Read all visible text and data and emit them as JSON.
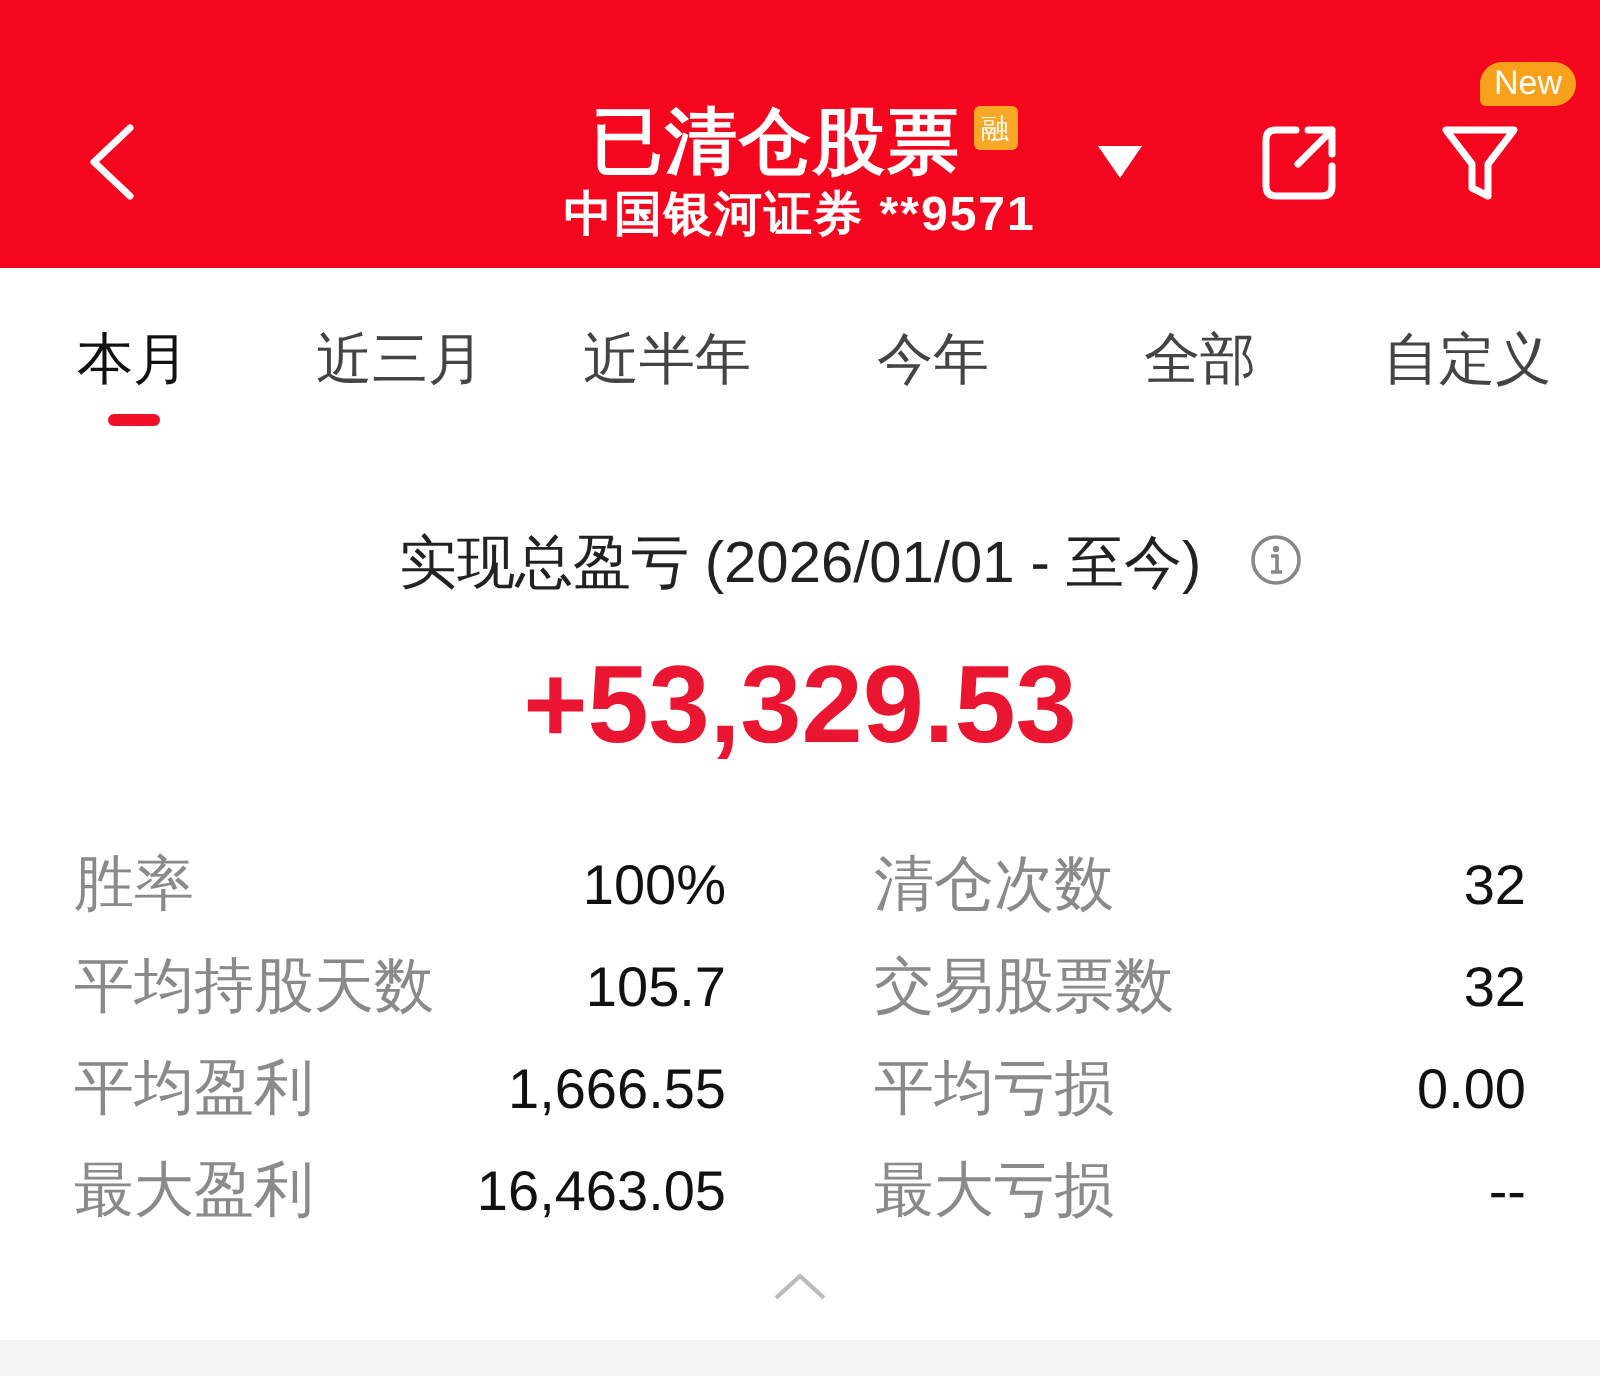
{
  "header": {
    "title": "已清仓股票",
    "badge": "融",
    "account": "中国银河证券 **9571",
    "filter_badge": "New"
  },
  "tabs": [
    {
      "label": "本月",
      "selected": true
    },
    {
      "label": "近三月",
      "selected": false
    },
    {
      "label": "近半年",
      "selected": false
    },
    {
      "label": "今年",
      "selected": false
    },
    {
      "label": "全部",
      "selected": false
    },
    {
      "label": "自定义",
      "selected": false
    }
  ],
  "summary": {
    "title": "实现总盈亏 (2026/01/01 - 至今)",
    "value": "+53,329.53"
  },
  "stats": [
    {
      "label": "胜率",
      "value": "100%"
    },
    {
      "label": "清仓次数",
      "value": "32"
    },
    {
      "label": "平均持股天数",
      "value": "105.7"
    },
    {
      "label": "交易股票数",
      "value": "32"
    },
    {
      "label": "平均盈利",
      "value": "1,666.55"
    },
    {
      "label": "平均亏损",
      "value": "0.00"
    },
    {
      "label": "最大盈利",
      "value": "16,463.05"
    },
    {
      "label": "最大亏损",
      "value": "--"
    }
  ]
}
